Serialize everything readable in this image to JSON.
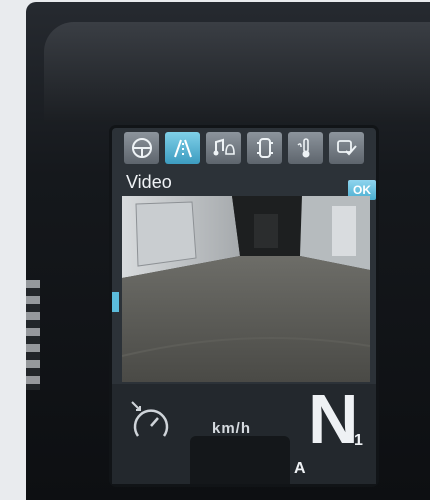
{
  "screen": {
    "title": "Video",
    "ok_label": "OK",
    "toolbar": [
      {
        "icon": "steering-wheel-icon"
      },
      {
        "icon": "road-camera-icon",
        "active": true
      },
      {
        "icon": "music-bell-icon"
      },
      {
        "icon": "car-top-icon"
      },
      {
        "icon": "temperature-icon"
      },
      {
        "icon": "settings-check-icon"
      }
    ]
  },
  "status": {
    "speed_unit": "km/h",
    "gear": "N",
    "gear_sub": "1",
    "mode": "A"
  },
  "colors": {
    "accent": "#5bbcdc",
    "screen_bg": "#2c3238",
    "tool_bg": "#7b838b"
  }
}
